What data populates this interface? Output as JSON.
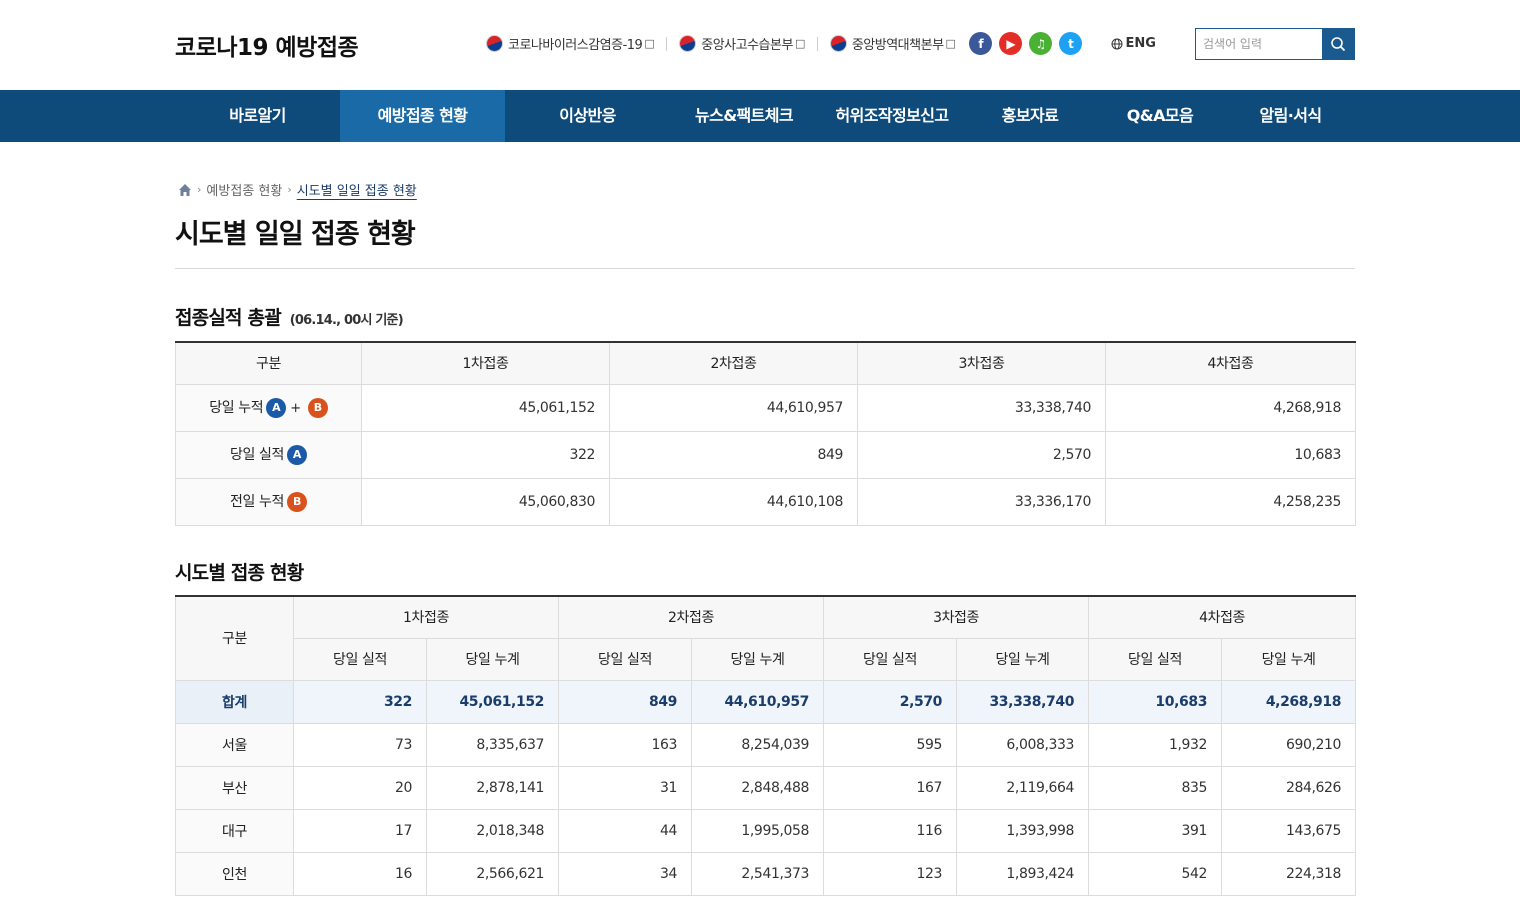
{
  "header": {
    "logo": "코로나19 예방접종",
    "ext_links": [
      {
        "label": "코로나바이러스감염증-19"
      },
      {
        "label": "중앙사고수습본부"
      },
      {
        "label": "중앙방역대책본부"
      }
    ],
    "newwin_glyph": "□",
    "sns": {
      "facebook": "f",
      "youtube": "▶",
      "kakao": "♫",
      "twitter": "t"
    },
    "lang": "ENG",
    "search_placeholder": "검색어 입력",
    "colors": {
      "nav_bg": "#0e4a7a",
      "nav_active": "#1a6aa8",
      "accent": "#1b5a8f"
    }
  },
  "nav": {
    "items": [
      {
        "label": "바로알기"
      },
      {
        "label": "예방접종 현황",
        "active": true
      },
      {
        "label": "이상반응"
      },
      {
        "label": "뉴스&팩트체크"
      },
      {
        "label": "허위조작정보신고"
      },
      {
        "label": "홍보자료"
      },
      {
        "label": "Q&A모음"
      },
      {
        "label": "알림·서식"
      }
    ]
  },
  "breadcrumb": {
    "parent": "예방접종 현황",
    "current": "시도별 일일 접종 현황"
  },
  "page_title": "시도별 일일 접종 현황",
  "summary": {
    "title": "접종실적 총괄",
    "subtitle": "(06.14., 00시 기준)",
    "headers": [
      "구분",
      "1차접종",
      "2차접종",
      "3차접종",
      "4차접종"
    ],
    "badges": {
      "a": "A",
      "b": "B",
      "plus": "+"
    },
    "rows": [
      {
        "label": "당일 누적",
        "values": [
          "45,061,152",
          "44,610,957",
          "33,338,740",
          "4,268,918"
        ]
      },
      {
        "label": "당일 실적",
        "values": [
          "322",
          "849",
          "2,570",
          "10,683"
        ]
      },
      {
        "label": "전일 누적",
        "values": [
          "45,060,830",
          "44,610,108",
          "33,336,170",
          "4,258,235"
        ]
      }
    ]
  },
  "regional": {
    "title": "시도별 접종 현황",
    "header_group": "구분",
    "doses": [
      "1차접종",
      "2차접종",
      "3차접종",
      "4차접종"
    ],
    "sub_headers": [
      "당일 실적",
      "당일 누계"
    ],
    "rows": [
      {
        "region": "합계",
        "values": [
          "322",
          "45,061,152",
          "849",
          "44,610,957",
          "2,570",
          "33,338,740",
          "10,683",
          "4,268,918"
        ]
      },
      {
        "region": "서울",
        "values": [
          "73",
          "8,335,637",
          "163",
          "8,254,039",
          "595",
          "6,008,333",
          "1,932",
          "690,210"
        ]
      },
      {
        "region": "부산",
        "values": [
          "20",
          "2,878,141",
          "31",
          "2,848,488",
          "167",
          "2,119,664",
          "835",
          "284,626"
        ]
      },
      {
        "region": "대구",
        "values": [
          "17",
          "2,018,348",
          "44",
          "1,995,058",
          "116",
          "1,393,998",
          "391",
          "143,675"
        ]
      },
      {
        "region": "인천",
        "values": [
          "16",
          "2,566,621",
          "34",
          "2,541,373",
          "123",
          "1,893,424",
          "542",
          "224,318"
        ]
      }
    ]
  }
}
